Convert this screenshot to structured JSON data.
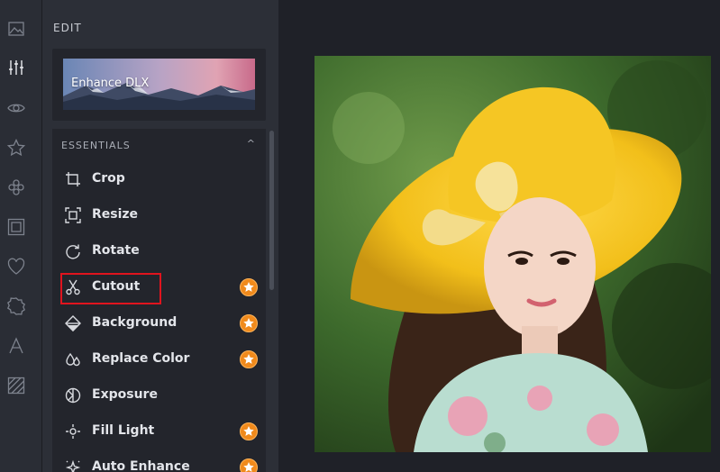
{
  "panel": {
    "title": "EDIT",
    "promo_label": "Enhance DLX",
    "section_header": "ESSENTIALS",
    "section_chevron": "^"
  },
  "rail": {
    "icons": [
      "image-icon",
      "sliders-icon",
      "eye-icon",
      "star-icon",
      "flower-icon",
      "frame-icon",
      "heart-icon",
      "badge-icon",
      "text-icon",
      "texture-icon"
    ]
  },
  "tools": [
    {
      "label": "Crop",
      "icon": "crop-icon",
      "premium": false
    },
    {
      "label": "Resize",
      "icon": "resize-icon",
      "premium": false
    },
    {
      "label": "Rotate",
      "icon": "rotate-icon",
      "premium": false
    },
    {
      "label": "Cutout",
      "icon": "scissors-icon",
      "premium": true
    },
    {
      "label": "Background",
      "icon": "background-icon",
      "premium": true
    },
    {
      "label": "Replace Color",
      "icon": "drops-icon",
      "premium": true
    },
    {
      "label": "Exposure",
      "icon": "exposure-icon",
      "premium": false
    },
    {
      "label": "Fill Light",
      "icon": "sun-icon",
      "premium": true
    },
    {
      "label": "Auto Enhance",
      "icon": "sparkle-icon",
      "premium": true
    }
  ],
  "colors": {
    "premium": "#f08a1c",
    "highlight": "#e0141e",
    "panel": "#2c2f37"
  }
}
